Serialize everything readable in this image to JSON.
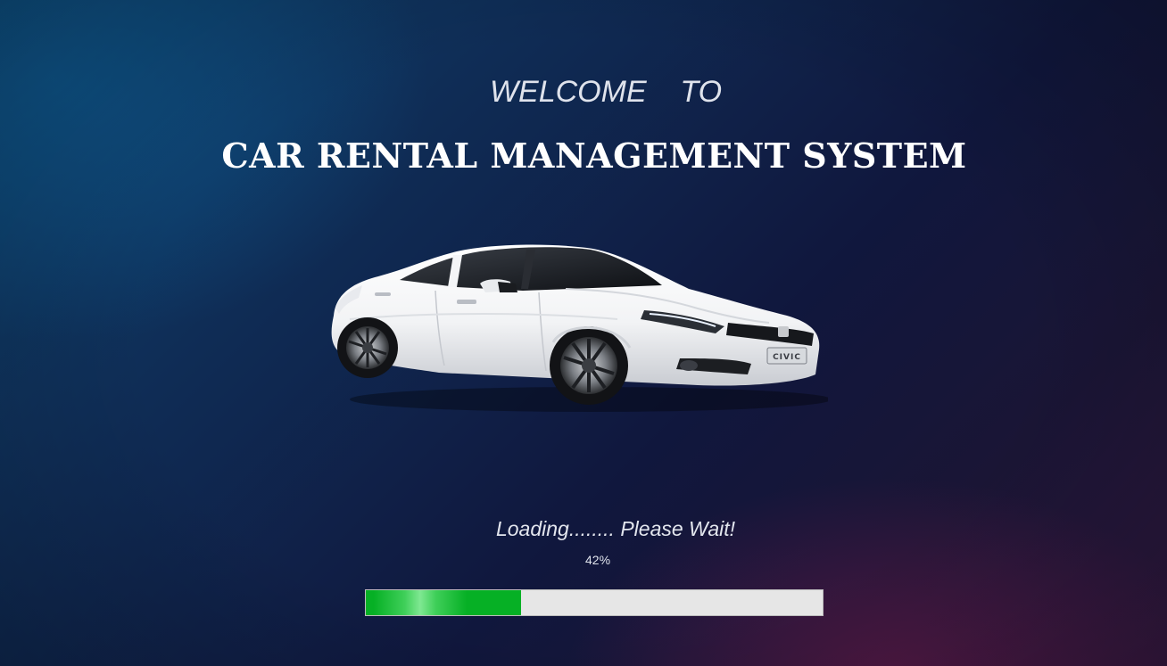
{
  "splash": {
    "welcome_text": "WELCOME    TO",
    "title": "CAR RENTAL MANAGEMENT SYSTEM",
    "car_image": "white-sedan-car-image",
    "car_badge": "CIVIC",
    "loading_text": "Loading........  Please Wait!",
    "progress_label": "42%",
    "progress_value": 0.34
  },
  "colors": {
    "background_top_left": "#0d4470",
    "background_mid": "#10173d",
    "background_bottom_right": "#30183f",
    "progress_fill": "#06b025",
    "progress_track": "#e6e6e6"
  }
}
